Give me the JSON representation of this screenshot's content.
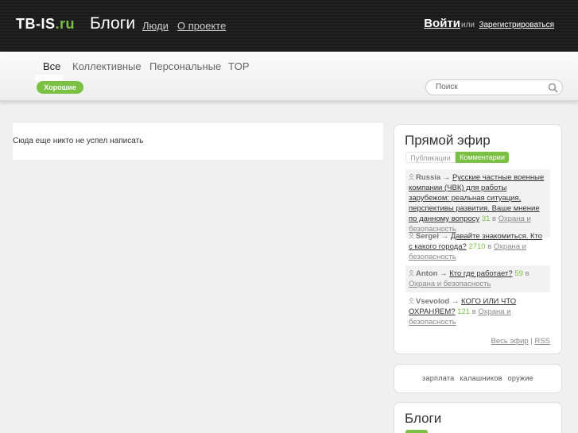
{
  "header": {
    "logo_main": "TB-IS",
    "logo_tld": ".ru",
    "nav_blogs": "Блоги",
    "nav_people": "Люди",
    "nav_about": "О проекте",
    "login": "Войти",
    "or": "или",
    "register": "Зарегистрироваться"
  },
  "subnav": {
    "tabs": [
      "Все",
      "Коллективные",
      "Персональные",
      "TOP"
    ],
    "filter_pill": "Хорошие",
    "search_placeholder": "Поиск"
  },
  "main": {
    "empty_message": "Сюда еще никто не успел написать"
  },
  "live": {
    "title": "Прямой эфир",
    "tab_publications": "Публикации",
    "tab_comments": "Комментарии",
    "items": [
      {
        "user": "Russia",
        "topic": "Русские частные военные компании (ЧВК) для работы зарубежом: реальная ситуация, перспективы развития. Ваше мнение по данному вопросу",
        "count": "31",
        "in": "в",
        "blog": "Охрана и безопасность"
      },
      {
        "user": "Sergei",
        "topic": "Давайте знакомиться. Кто с какого города?",
        "count": "2710",
        "in": "в",
        "blog": "Охрана и безопасность"
      },
      {
        "user": "Anton",
        "topic": "Кто где работает?",
        "count": "59",
        "in": "в",
        "blog": "Охрана и безопасность"
      },
      {
        "user": "Vsevolod",
        "topic": "КОГО ИЛИ ЧТО ОХРАНЯЕМ?",
        "count": "121",
        "in": "в",
        "blog": "Охрана и безопасность"
      }
    ],
    "arrow": "→",
    "all_live": "Весь эфир",
    "separator": "|",
    "rss": "RSS"
  },
  "tags": [
    "зарплата",
    "калашников",
    "оружие"
  ],
  "blogs": {
    "title": "Блоги"
  },
  "colors": {
    "accent": "#7ac143",
    "header_bg": "#1e1e1e"
  }
}
